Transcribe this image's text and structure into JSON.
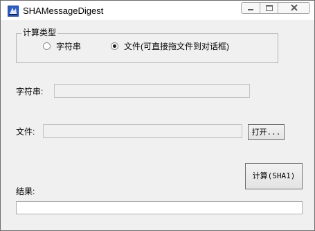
{
  "window": {
    "title": "SHAMessageDigest"
  },
  "group": {
    "legend": "计算类型",
    "options": [
      {
        "label": "字符串",
        "selected": false
      },
      {
        "label": "文件(可直接拖文件到对话框)",
        "selected": true
      }
    ]
  },
  "string_field": {
    "label": "字符串:",
    "value": ""
  },
  "file_field": {
    "label": "文件:",
    "value": "",
    "open_button": "打开..."
  },
  "compute_button": "计算(SHA1)",
  "result_field": {
    "label": "结果:",
    "value": ""
  },
  "icons": {
    "app": "sha-app-icon",
    "minimize": "minimize-icon",
    "maximize": "maximize-icon",
    "close": "close-icon"
  }
}
